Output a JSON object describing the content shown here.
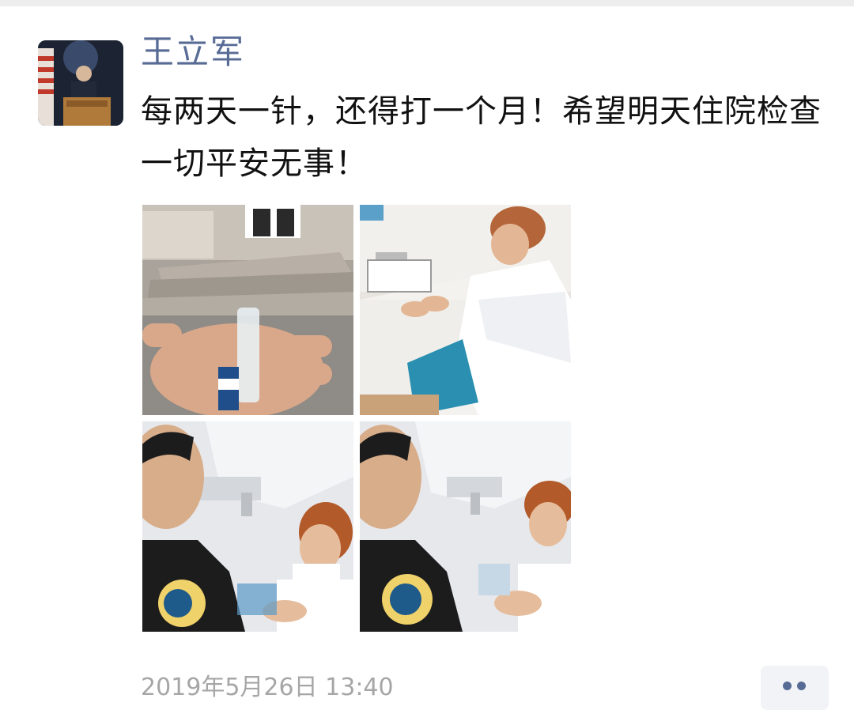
{
  "post": {
    "author": "王立军",
    "text": "每两天一针，还得打一个月！希望明天住院检查一切平安无事！",
    "timestamp": "2019年5月26日 13:40"
  },
  "photos": [
    {
      "label": "photo-vial-in-hand"
    },
    {
      "label": "photo-nurse-preparing-syringe"
    },
    {
      "label": "photo-selfie-with-nurse-1"
    },
    {
      "label": "photo-selfie-with-nurse-2"
    }
  ],
  "colors": {
    "author_name": "#576b95",
    "body_text": "#111111",
    "timestamp": "#a6a6a6",
    "more_button_bg": "#f2f3f6"
  },
  "icons": {
    "more": "more-dots-icon"
  }
}
